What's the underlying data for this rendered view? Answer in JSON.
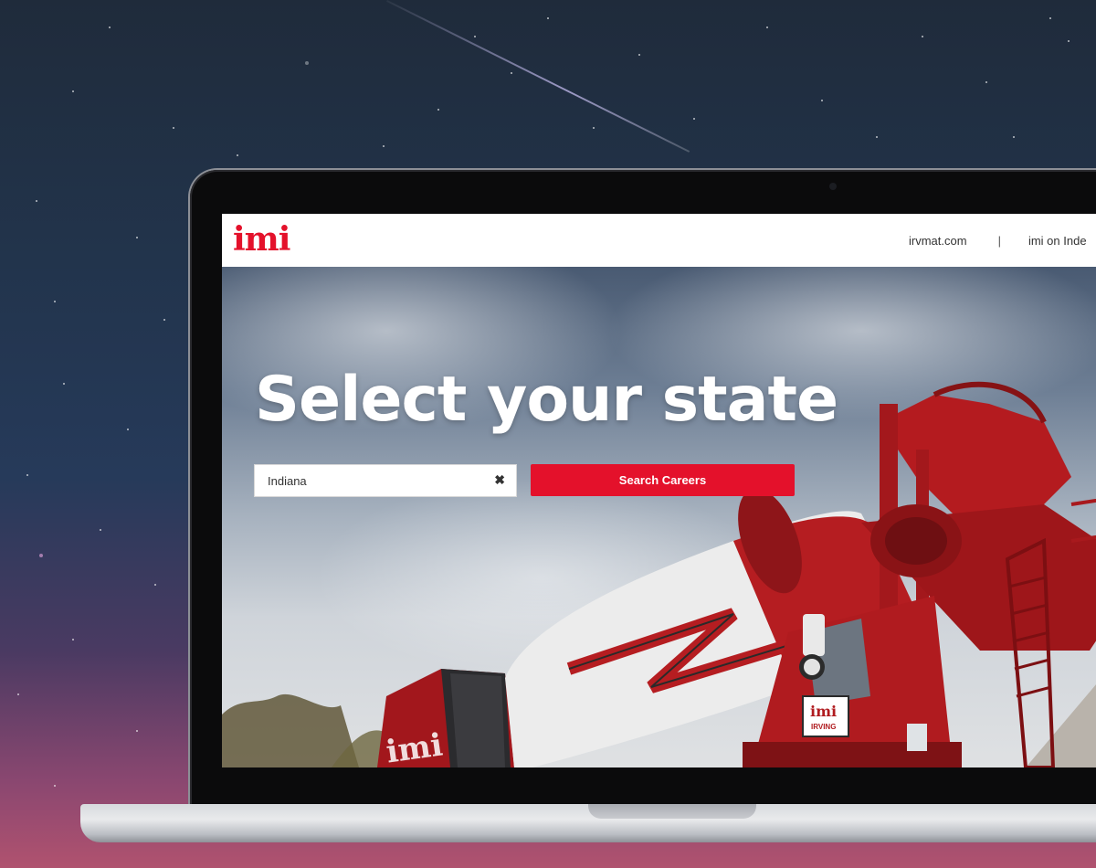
{
  "header": {
    "logo_text": "imi",
    "nav": [
      {
        "label": "irvmat.com"
      },
      {
        "separator": "|"
      },
      {
        "label": "imi on Inde"
      }
    ]
  },
  "hero": {
    "title": "Select your state",
    "state_input": {
      "value": "Indiana"
    },
    "search_button_label": "Search Careers",
    "truck_badge": {
      "logo_text": "imi",
      "subtitle": "IRVING"
    },
    "drum_logo_text": "imi"
  },
  "colors": {
    "brand_red": "#e4112b",
    "header_bg": "#ffffff"
  },
  "icons": {
    "clear": "close-icon"
  }
}
